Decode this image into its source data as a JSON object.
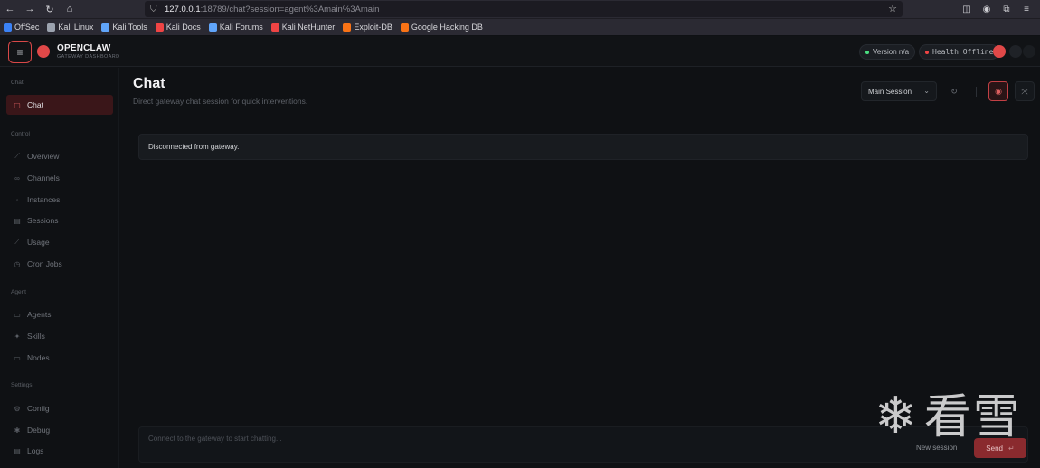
{
  "browser": {
    "url_host": "127.0.0.1",
    "url_rest": ":18789/chat?session=agent%3Amain%3Amain",
    "bookmarks": [
      {
        "label": "OffSec",
        "color": "#3b82f6"
      },
      {
        "label": "Kali Linux",
        "color": "#9ca3af"
      },
      {
        "label": "Kali Tools",
        "color": "#60a5fa"
      },
      {
        "label": "Kali Docs",
        "color": "#ef4444"
      },
      {
        "label": "Kali Forums",
        "color": "#60a5fa"
      },
      {
        "label": "Kali NetHunter",
        "color": "#ef4444"
      },
      {
        "label": "Exploit-DB",
        "color": "#f97316"
      },
      {
        "label": "Google Hacking DB",
        "color": "#f97316"
      }
    ]
  },
  "header": {
    "brand": "OPENCLAW",
    "brand_sub": "GATEWAY DASHBOARD",
    "version_label": "Version n/a",
    "health_label": "Health Offline",
    "colors": {
      "accent": "#e04848",
      "version_dot": "#4ade80",
      "health_dot": "#ef4444"
    }
  },
  "sidebar": {
    "groups": [
      {
        "label": "Chat",
        "items": [
          {
            "label": "Chat",
            "icon": "chat-icon",
            "active": true
          }
        ]
      },
      {
        "label": "Control",
        "items": [
          {
            "label": "Overview",
            "icon": "chart-icon"
          },
          {
            "label": "Channels",
            "icon": "link-icon"
          },
          {
            "label": "Instances",
            "icon": "radio-icon"
          },
          {
            "label": "Sessions",
            "icon": "document-icon"
          },
          {
            "label": "Usage",
            "icon": "bar-icon"
          },
          {
            "label": "Cron Jobs",
            "icon": "clock-icon"
          }
        ]
      },
      {
        "label": "Agent",
        "items": [
          {
            "label": "Agents",
            "icon": "folder-icon"
          },
          {
            "label": "Skills",
            "icon": "sparkle-icon"
          },
          {
            "label": "Nodes",
            "icon": "monitor-icon"
          }
        ]
      },
      {
        "label": "Settings",
        "items": [
          {
            "label": "Config",
            "icon": "gear-icon"
          },
          {
            "label": "Debug",
            "icon": "bug-icon"
          },
          {
            "label": "Logs",
            "icon": "file-icon"
          }
        ]
      }
    ]
  },
  "main": {
    "title": "Chat",
    "subtitle": "Direct gateway chat session for quick interventions.",
    "session_select": "Main Session",
    "alert": "Disconnected from gateway.",
    "composer_placeholder": "Connect to the gateway to start chatting...",
    "new_session": "New session",
    "send": "Send"
  },
  "watermark": "看雪"
}
